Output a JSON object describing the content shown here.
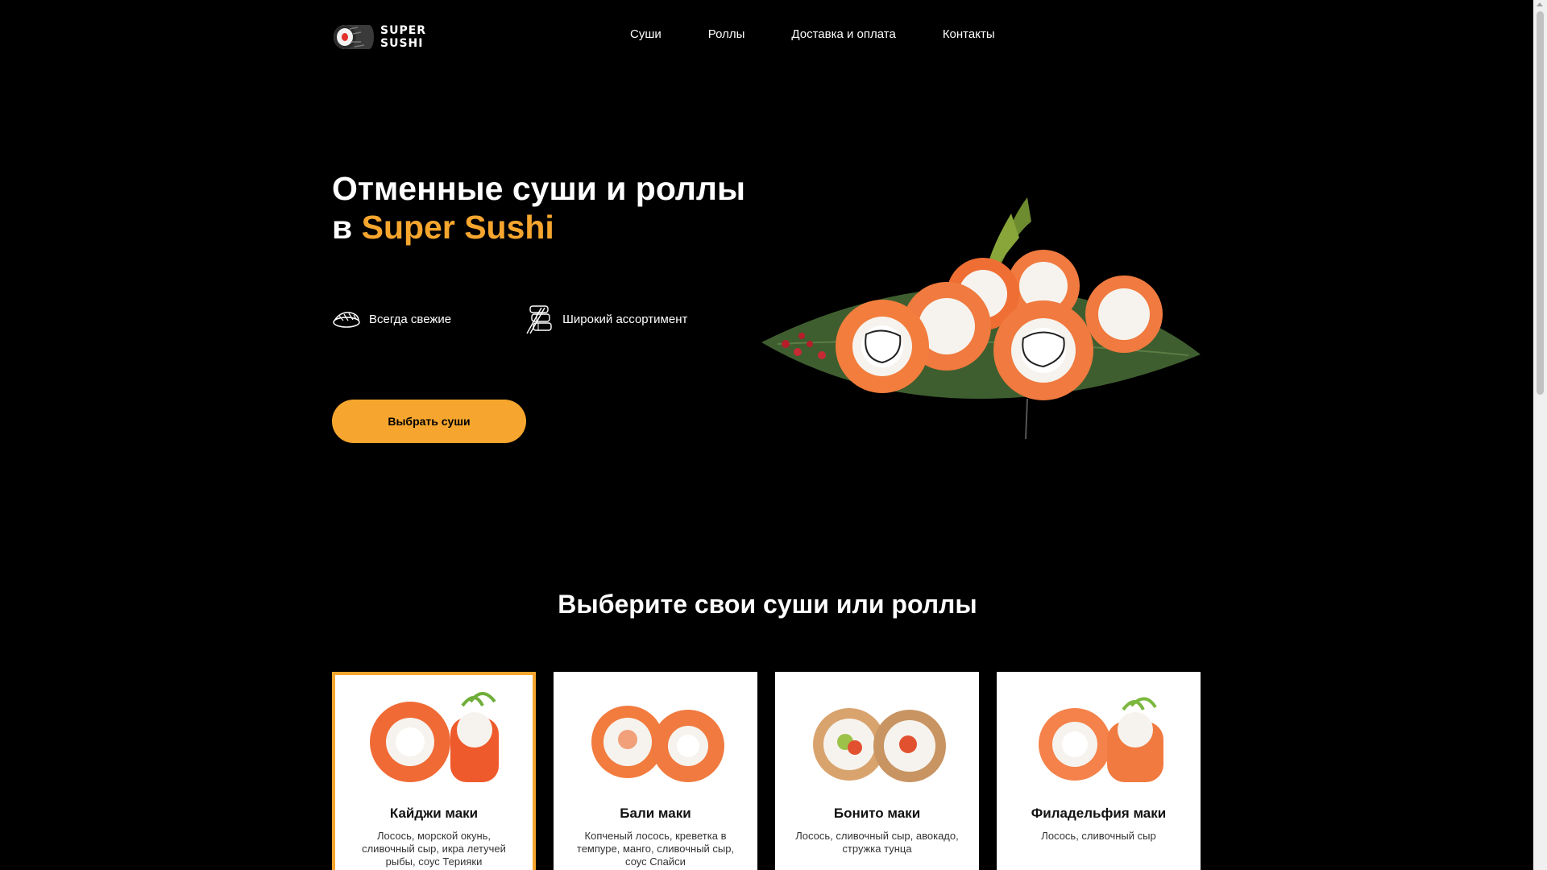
{
  "header": {
    "logo_line1": "SUPER",
    "logo_line2": "SUSHI",
    "nav": [
      "Суши",
      "Роллы",
      "Доставка и оплата",
      "Контакты"
    ]
  },
  "hero": {
    "title_line1": "Отменные суши и роллы",
    "title_prefix": "в ",
    "title_accent": "Super Sushi",
    "features": [
      "Всегда свежие",
      "Широкий ассортимент"
    ],
    "cta_label": "Выбрать суши"
  },
  "section": {
    "title": "Выберите свои суши или роллы"
  },
  "products": [
    {
      "name": "Кайджи маки",
      "desc": "Лосось, морской окунь, сливочный сыр, икра летучей рыбы, соус Терияки"
    },
    {
      "name": "Бали маки",
      "desc": "Копченый лосось, креветка в темпуре, манго, сливочный сыр, соус Спайси"
    },
    {
      "name": "Бонито маки",
      "desc": "Лосось, сливочный сыр, авокадо, стружка тунца"
    },
    {
      "name": "Филадельфия маки",
      "desc": "Лосось, сливочный сыр"
    }
  ],
  "colors": {
    "accent": "#f6a62e",
    "background": "#000000",
    "card": "#ffffff"
  },
  "icons": [
    "logo-roll-icon",
    "sushi-fresh-icon",
    "sushi-assortment-icon"
  ]
}
